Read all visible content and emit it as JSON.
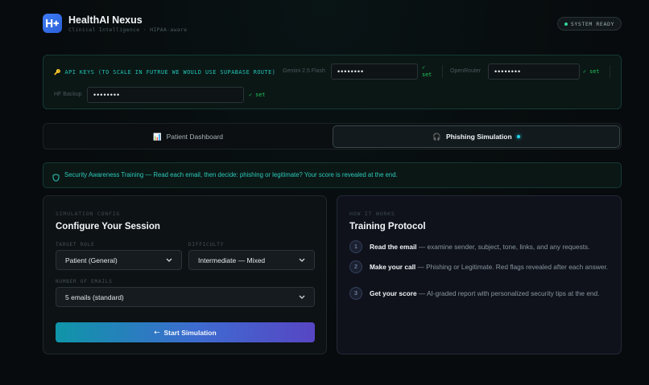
{
  "app": {
    "title": "HealthAI Nexus",
    "subtitle": "Clinical Intelligence · HIPAA-aware",
    "status": "SYSTEM READY"
  },
  "api_keys": {
    "title": "🔑 API KEYS (TO SCALE IN FUTRUE WE WOULD USE SUPABASE ROUTE)",
    "gemini_label": "Gemini 2.5 Flash",
    "gemini_value": "••••••••",
    "openrouter_label": "OpenRouter",
    "openrouter_value": "••••••••",
    "hf_label": "HF Backup",
    "hf_value": "••••••••",
    "set_label": "✓ set"
  },
  "tabs": [
    {
      "icon": "📊",
      "label": "Patient Dashboard"
    },
    {
      "icon": "🎧",
      "label": "Phishing Simulation"
    }
  ],
  "banner": {
    "text": "Security Awareness Training — Read each email, then decide: phishing or legitimate? Your score is revealed at the end."
  },
  "config": {
    "eyebrow": "SIMULATION CONFIG",
    "title": "Configure Your Session",
    "role_label": "TARGET ROLE",
    "role_value": "Patient (General)",
    "difficulty_label": "DIFFICULTY",
    "difficulty_value": "Intermediate — Mixed",
    "count_label": "NUMBER OF EMAILS",
    "count_value": "5 emails (standard)",
    "start_label": "Start Simulation",
    "start_icon": "⇠"
  },
  "how": {
    "eyebrow": "HOW IT WORKS",
    "title": "Training Protocol",
    "steps": [
      {
        "num": "1",
        "title": "Read the email",
        "text": " — examine sender, subject, tone, links, and any requests."
      },
      {
        "num": "2",
        "title": "Make your call",
        "text": " — Phishing or Legitimate. Red flags revealed after each answer."
      },
      {
        "num": "3",
        "title": "Get your score",
        "text": " — AI-graded report with personalized security tips at the end."
      }
    ]
  },
  "colors": {
    "accent_teal": "#22c3b5",
    "success_green": "#22c55e",
    "button_gradient_start": "#0f95a8",
    "button_gradient_end": "#5746c4"
  }
}
